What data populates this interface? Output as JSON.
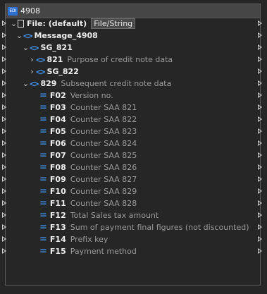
{
  "window": {
    "title": "4908",
    "icon": "edi-icon"
  },
  "file": {
    "label": "File: (default)",
    "tag": "File/String"
  },
  "message": {
    "label": "Message_4908"
  },
  "sg821": {
    "label": "SG_821"
  },
  "seg821": {
    "code": "821",
    "desc": "Purpose of credit note data"
  },
  "sg822": {
    "label": "SG_822"
  },
  "seg829": {
    "code": "829",
    "desc": "Subsequent credit note data"
  },
  "fields": [
    {
      "code": "F02",
      "desc": "Version no."
    },
    {
      "code": "F03",
      "desc": "Counter SAA 821"
    },
    {
      "code": "F04",
      "desc": "Counter SAA 822"
    },
    {
      "code": "F05",
      "desc": "Counter SAA 823"
    },
    {
      "code": "F06",
      "desc": "Counter SAA 824"
    },
    {
      "code": "F07",
      "desc": "Counter SAA 825"
    },
    {
      "code": "F08",
      "desc": "Counter SAA 826"
    },
    {
      "code": "F09",
      "desc": "Counter SAA 827"
    },
    {
      "code": "F10",
      "desc": "Counter SAA 829"
    },
    {
      "code": "F11",
      "desc": "Counter SAA 828"
    },
    {
      "code": "F12",
      "desc": "Total Sales tax amount"
    },
    {
      "code": "F13",
      "desc": "Sum of payment final figures (not discounted)"
    },
    {
      "code": "F14",
      "desc": "Prefix key"
    },
    {
      "code": "F15",
      "desc": "Payment method"
    }
  ],
  "colors": {
    "accent": "#3d8ee8",
    "background": "#262626",
    "titlebar": "#464646"
  }
}
